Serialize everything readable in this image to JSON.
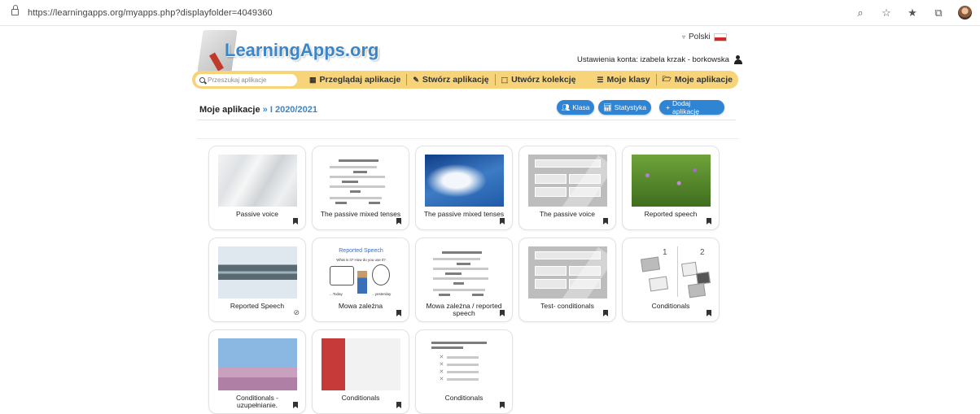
{
  "browser": {
    "url": "https://learningapps.org/myapps.php?displayfolder=4049360"
  },
  "header": {
    "logo_text": "LearningApps.org",
    "language": "Polski",
    "account": "Ustawienia konta: izabela krzak - borkowska"
  },
  "nav": {
    "search_placeholder": "Przeszukaj aplikacje",
    "browse": "Przeglądaj aplikacje",
    "create": "Stwórz aplikację",
    "collection": "Utwórz kolekcję",
    "classes": "Moje klasy",
    "myapps": "Moje aplikacje"
  },
  "page": {
    "title": "Moje aplikacje",
    "separator": "»",
    "folder": "I 2020/2021",
    "btn_class": "Klasa",
    "btn_stats": "Statystyka",
    "btn_add": "Dodaj aplikację"
  },
  "apps": [
    {
      "title": "Passive voice",
      "thumb": "marble",
      "icon": "bookmark-icon"
    },
    {
      "title": "The passive mixed tenses",
      "thumb": "lines",
      "icon": "bookmark-icon"
    },
    {
      "title": "The passive mixed tenses",
      "thumb": "sky",
      "icon": "bookmark-icon"
    },
    {
      "title": "The passive voice",
      "thumb": "boxes",
      "icon": "bookmark-icon"
    },
    {
      "title": "Reported speech",
      "thumb": "field",
      "icon": "bookmark-icon"
    },
    {
      "title": "Reported Speech",
      "thumb": "lake",
      "icon": "hidden-eye-icon"
    },
    {
      "title": "Mowa zależna",
      "thumb": "reported",
      "thumb_title": "Reported Speech",
      "thumb_text": "What is it?  How do you use it?",
      "thumb_left": "...Today",
      "thumb_right": "...yesterday",
      "icon": "bookmark-icon"
    },
    {
      "title": "Mowa zależna / reported speech",
      "thumb": "lines",
      "icon": "bookmark-icon"
    },
    {
      "title": "Test- conditionals",
      "thumb": "boxes",
      "icon": "bookmark-icon"
    },
    {
      "title": "Conditionals",
      "thumb": "collection",
      "num1": "1",
      "num2": "2",
      "icon": "bookmark-icon"
    },
    {
      "title": "Conditionals - uzupełnianie.",
      "thumb": "heather",
      "icon": "bookmark-icon"
    },
    {
      "title": "Conditionals",
      "thumb": "popcorn",
      "icon": "bookmark-icon"
    },
    {
      "title": "Conditionals",
      "thumb": "list",
      "icon": "bookmark-icon"
    }
  ],
  "colors": {
    "nav_bg": "#f7d37a",
    "accent": "#3a86c8",
    "button": "#2f84d4"
  }
}
